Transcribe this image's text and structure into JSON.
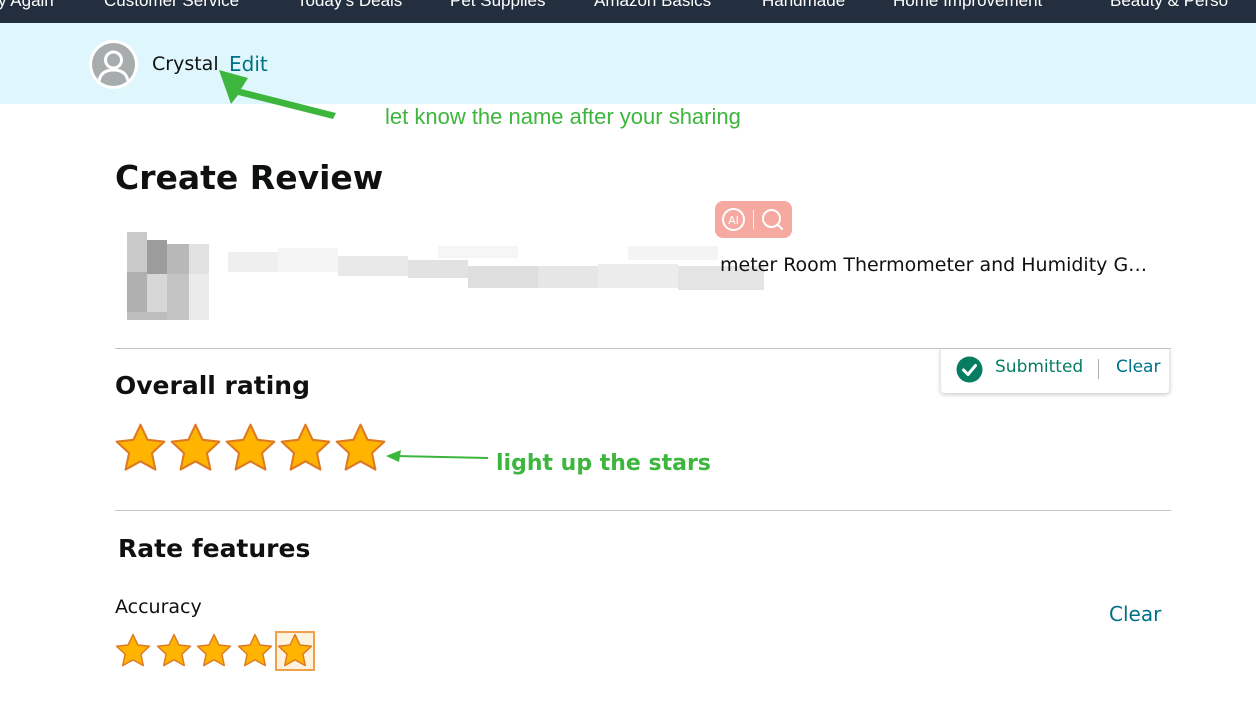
{
  "nav": {
    "items": [
      "y Again",
      "Customer Service",
      "Today's Deals",
      "Pet Supplies",
      "Amazon Basics",
      "Handmade",
      "Home Improvement",
      "Beauty & Perso"
    ]
  },
  "profile": {
    "name": "Crystal",
    "edit_label": "Edit",
    "avatar_icon": "user-silhouette-icon"
  },
  "annotations": {
    "name_hint": "let know the name after your sharing",
    "stars_hint": "light up the stars",
    "color": "#3db63d"
  },
  "page": {
    "title": "Create Review"
  },
  "product": {
    "visible_title": "meter Room Thermometer and Humidity G…",
    "ai_search_icons": [
      "ai-icon",
      "search-icon"
    ]
  },
  "overall_rating": {
    "heading": "Overall rating",
    "stars": 5,
    "max": 5,
    "status_text": "Submitted",
    "clear_label": "Clear",
    "status_icon": "check-circle-icon",
    "status_color": "#067d62"
  },
  "features": {
    "heading": "Rate features",
    "items": [
      {
        "label": "Accuracy",
        "stars": 5,
        "max": 5,
        "clear_label": "Clear"
      }
    ]
  },
  "colors": {
    "star_fill": "#ffb400",
    "star_stroke": "#de7921",
    "link": "#007185",
    "nav_bg": "#232f3e",
    "profile_bg": "#dff7fc"
  }
}
